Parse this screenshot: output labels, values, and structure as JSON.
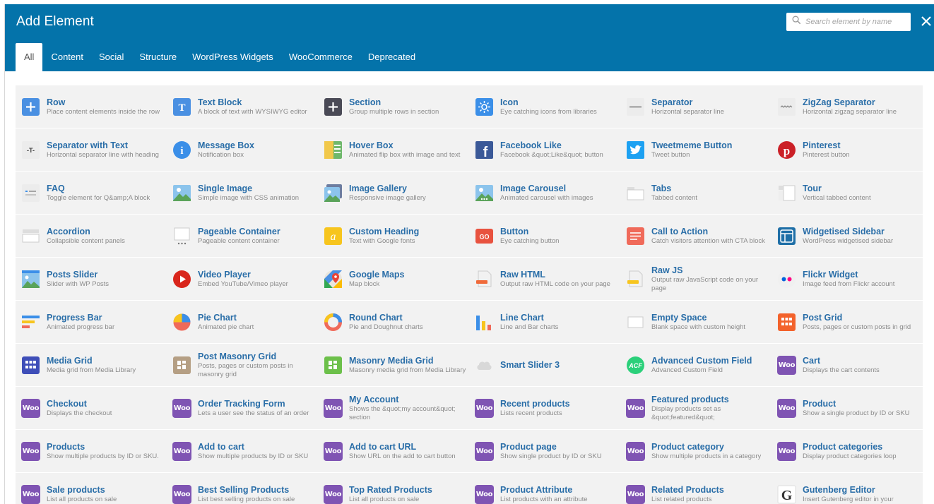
{
  "header": {
    "title": "Add Element",
    "search_placeholder": "Search element by name",
    "close_icon": "close-icon"
  },
  "tabs": [
    {
      "label": "All",
      "active": true
    },
    {
      "label": "Content"
    },
    {
      "label": "Social"
    },
    {
      "label": "Structure"
    },
    {
      "label": "WordPress Widgets"
    },
    {
      "label": "WooCommerce"
    },
    {
      "label": "Deprecated"
    }
  ],
  "elements": [
    {
      "name": "Row",
      "desc": "Place content elements inside the row",
      "icon": "row-icon"
    },
    {
      "name": "Text Block",
      "desc": "A block of text with WYSIWYG editor",
      "icon": "text-block-icon"
    },
    {
      "name": "Section",
      "desc": "Group multiple rows in section",
      "icon": "section-icon"
    },
    {
      "name": "Icon",
      "desc": "Eye catching icons from libraries",
      "icon": "sun-icon"
    },
    {
      "name": "Separator",
      "desc": "Horizontal separator line",
      "icon": "separator-icon"
    },
    {
      "name": "ZigZag Separator",
      "desc": "Horizontal zigzag separator line",
      "icon": "zigzag-icon"
    },
    {
      "name": "Separator with Text",
      "desc": "Horizontal separator line with heading",
      "icon": "separator-text-icon"
    },
    {
      "name": "Message Box",
      "desc": "Notification box",
      "icon": "info-icon"
    },
    {
      "name": "Hover Box",
      "desc": "Animated flip box with image and text",
      "icon": "hover-box-icon"
    },
    {
      "name": "Facebook Like",
      "desc": "Facebook &quot;Like&quot; button",
      "icon": "facebook-icon"
    },
    {
      "name": "Tweetmeme Button",
      "desc": "Tweet button",
      "icon": "twitter-icon"
    },
    {
      "name": "Pinterest",
      "desc": "Pinterest button",
      "icon": "pinterest-icon"
    },
    {
      "name": "FAQ",
      "desc": "Toggle element for Q&amp;A block",
      "icon": "faq-icon"
    },
    {
      "name": "Single Image",
      "desc": "Simple image with CSS animation",
      "icon": "image-icon"
    },
    {
      "name": "Image Gallery",
      "desc": "Responsive image gallery",
      "icon": "gallery-icon"
    },
    {
      "name": "Image Carousel",
      "desc": "Animated carousel with images",
      "icon": "carousel-icon"
    },
    {
      "name": "Tabs",
      "desc": "Tabbed content",
      "icon": "tabs-icon"
    },
    {
      "name": "Tour",
      "desc": "Vertical tabbed content",
      "icon": "tour-icon"
    },
    {
      "name": "Accordion",
      "desc": "Collapsible content panels",
      "icon": "accordion-icon"
    },
    {
      "name": "Pageable Container",
      "desc": "Pageable content container",
      "icon": "pageable-icon"
    },
    {
      "name": "Custom Heading",
      "desc": "Text with Google fonts",
      "icon": "heading-icon"
    },
    {
      "name": "Button",
      "desc": "Eye catching button",
      "icon": "button-go-icon"
    },
    {
      "name": "Call to Action",
      "desc": "Catch visitors attention with CTA block",
      "icon": "cta-icon"
    },
    {
      "name": "Widgetised Sidebar",
      "desc": "WordPress widgetised sidebar",
      "icon": "sidebar-icon"
    },
    {
      "name": "Posts Slider",
      "desc": "Slider with WP Posts",
      "icon": "posts-slider-icon"
    },
    {
      "name": "Video Player",
      "desc": "Embed YouTube/Vimeo player",
      "icon": "play-icon"
    },
    {
      "name": "Google Maps",
      "desc": "Map block",
      "icon": "map-icon"
    },
    {
      "name": "Raw HTML",
      "desc": "Output raw HTML code on your page",
      "icon": "raw-html-icon"
    },
    {
      "name": "Raw JS",
      "desc": "Output raw JavaScript code on your page",
      "icon": "raw-js-icon"
    },
    {
      "name": "Flickr Widget",
      "desc": "Image feed from Flickr account",
      "icon": "flickr-icon"
    },
    {
      "name": "Progress Bar",
      "desc": "Animated progress bar",
      "icon": "progress-icon"
    },
    {
      "name": "Pie Chart",
      "desc": "Animated pie chart",
      "icon": "pie-chart-icon"
    },
    {
      "name": "Round Chart",
      "desc": "Pie and Doughnut charts",
      "icon": "donut-icon"
    },
    {
      "name": "Line Chart",
      "desc": "Line and Bar charts",
      "icon": "bar-chart-icon"
    },
    {
      "name": "Empty Space",
      "desc": "Blank space with custom height",
      "icon": "empty-space-icon"
    },
    {
      "name": "Post Grid",
      "desc": "Posts, pages or custom posts in grid",
      "icon": "post-grid-icon"
    },
    {
      "name": "Media Grid",
      "desc": "Media grid from Media Library",
      "icon": "media-grid-icon"
    },
    {
      "name": "Post Masonry Grid",
      "desc": "Posts, pages or custom posts in masonry grid",
      "icon": "masonry-icon"
    },
    {
      "name": "Masonry Media Grid",
      "desc": "Masonry media grid from Media Library",
      "icon": "masonry-media-icon"
    },
    {
      "name": "Smart Slider 3",
      "desc": "",
      "icon": "cloud-icon"
    },
    {
      "name": "Advanced Custom Field",
      "desc": "Advanced Custom Field",
      "icon": "acf-icon"
    },
    {
      "name": "Cart",
      "desc": "Displays the cart contents",
      "icon": "woo-icon"
    },
    {
      "name": "Checkout",
      "desc": "Displays the checkout",
      "icon": "woo-icon"
    },
    {
      "name": "Order Tracking Form",
      "desc": "Lets a user see the status of an order",
      "icon": "woo-icon"
    },
    {
      "name": "My Account",
      "desc": "Shows the &quot;my account&quot; section",
      "icon": "woo-icon"
    },
    {
      "name": "Recent products",
      "desc": "Lists recent products",
      "icon": "woo-icon"
    },
    {
      "name": "Featured products",
      "desc": "Display products set as &quot;featured&quot;",
      "icon": "woo-icon"
    },
    {
      "name": "Product",
      "desc": "Show a single product by ID or SKU",
      "icon": "woo-icon"
    },
    {
      "name": "Products",
      "desc": "Show multiple products by ID or SKU.",
      "icon": "woo-icon"
    },
    {
      "name": "Add to cart",
      "desc": "Show multiple products by ID or SKU",
      "icon": "woo-icon"
    },
    {
      "name": "Add to cart URL",
      "desc": "Show URL on the add to cart button",
      "icon": "woo-icon"
    },
    {
      "name": "Product page",
      "desc": "Show single product by ID or SKU",
      "icon": "woo-icon"
    },
    {
      "name": "Product category",
      "desc": "Show multiple products in a category",
      "icon": "woo-icon"
    },
    {
      "name": "Product categories",
      "desc": "Display product categories loop",
      "icon": "woo-icon"
    },
    {
      "name": "Sale products",
      "desc": "List all products on sale",
      "icon": "woo-icon"
    },
    {
      "name": "Best Selling Products",
      "desc": "List best selling products on sale",
      "icon": "woo-icon"
    },
    {
      "name": "Top Rated Products",
      "desc": "List all products on sale",
      "icon": "woo-icon"
    },
    {
      "name": "Product Attribute",
      "desc": "List products with an attribute",
      "icon": "woo-icon"
    },
    {
      "name": "Related Products",
      "desc": "List related products",
      "icon": "woo-icon"
    },
    {
      "name": "Gutenberg Editor",
      "desc": "Insert Gutenberg editor in your",
      "icon": "gutenberg-icon"
    }
  ],
  "colors": {
    "header_bg": "#0473aa",
    "name_text": "#2a6ea8",
    "woo_purple": "#7f54b3",
    "grid_bg": "#f2f2f2"
  }
}
